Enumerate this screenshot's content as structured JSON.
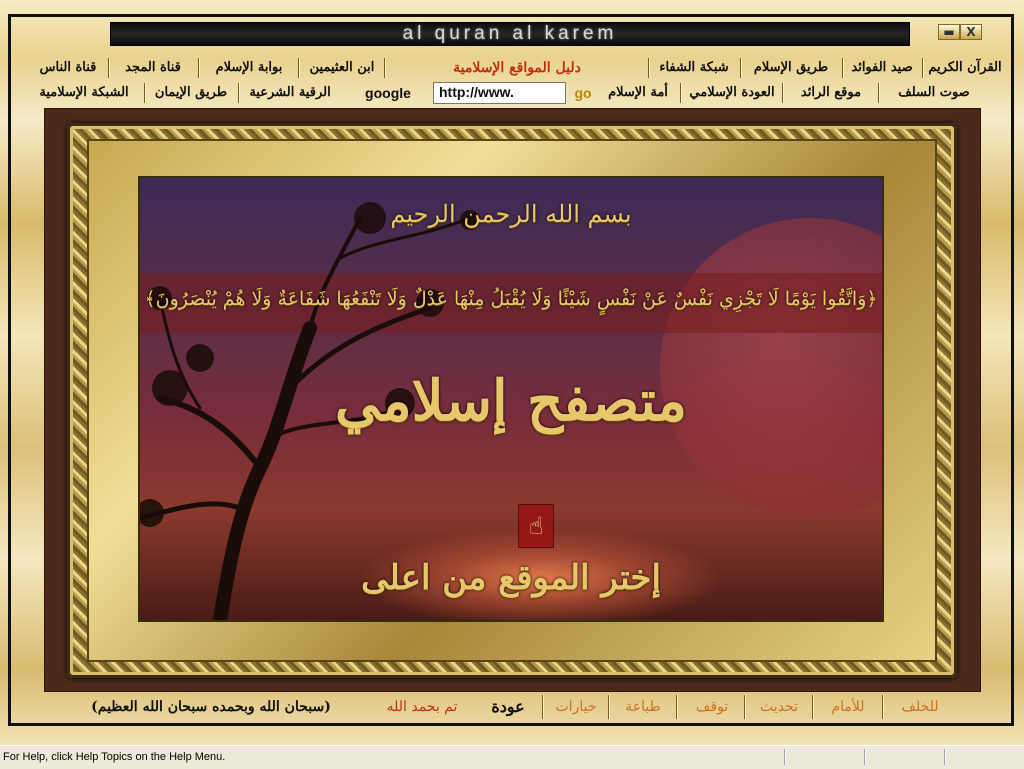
{
  "window": {
    "title": "al quran al karem",
    "minimize": "▬",
    "close": "X"
  },
  "top_links": [
    "القرآن الكريم",
    "صيد الفوائد",
    "طريق الإسلام",
    "شبكة الشفاء",
    "دليل المواقع الإسلامية",
    "ابن العثيمين",
    "بوابة الإسلام",
    "قناة المجد",
    "قناة الناس"
  ],
  "second_links": [
    "صوت السلف",
    "موقع الرائد",
    "العودة الإسلامي",
    "أمة الإسلام",
    "الرقية الشرعية",
    "طريق الإيمان",
    "الشبكة الإسلامية"
  ],
  "address": {
    "value": "http://www.",
    "go_label": "go",
    "search_label": "google"
  },
  "content": {
    "basmala": "بسم الله الرحمن الرحيم",
    "verse": "﴿وَاتَّقُوا يَوْمًا لَا تَجْزِي نَفْسٌ عَنْ نَفْسٍ شَيْئًا وَلَا يُقْبَلُ مِنْهَا عَدْلٌ وَلَا تَنْفَعُهَا شَفَاعَةٌ وَلَا هُمْ يُنْصَرُونَ﴾",
    "app_name": "متصفح إسلامي",
    "instruction": "إختر الموقع من اعلى",
    "hand_icon": "hand-pointer-icon"
  },
  "bottom_bar": {
    "back": "للخلف",
    "forward": "للأمام",
    "refresh": "تحديث",
    "stop": "توقف",
    "print": "طباعة",
    "options": "خيارات",
    "home": "عودة",
    "done": "تم بحمد الله",
    "tasbih": "(سبحان الله وبحمده سبحان الله العظيم)"
  },
  "statusbar": {
    "text": "For Help, click Help Topics on the Help Menu."
  },
  "colors": {
    "gold": "#e8c66a",
    "link_red": "#c03010",
    "bottom_orange": "#d07020"
  }
}
